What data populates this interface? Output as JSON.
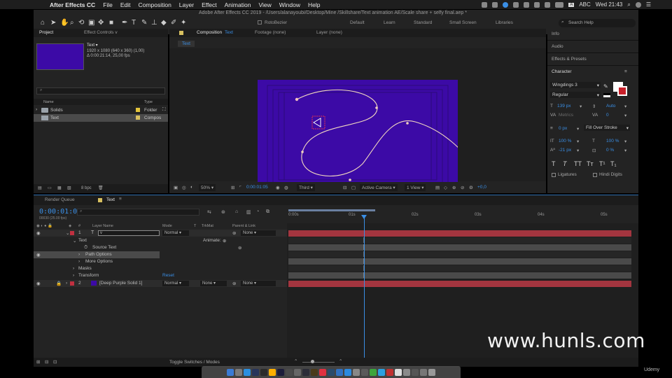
{
  "menubar": {
    "app_name": "After Effects CC",
    "items": [
      "File",
      "Edit",
      "Composition",
      "Layer",
      "Effect",
      "Animation",
      "View",
      "Window",
      "Help"
    ],
    "input_source": "ABC",
    "clock": "Wed 21:43"
  },
  "toolbar": {
    "window_title": "Adobe After Effects CC 2019 - /Users/alanayoubi/Desktop/Mine /Skillshare/Text animation AE/Scale share + selfy final.aep *",
    "rotobezier": "RotoBezier",
    "workspaces": [
      "Default",
      "Learn",
      "Standard",
      "Small Screen",
      "Libraries"
    ],
    "search_placeholder": "Search Help"
  },
  "project": {
    "tab_project": "Project",
    "tab_effects": "Effect Controls v",
    "selected_name": "Text ▾",
    "selected_dims": "1920 x 1080  (640 x 360) (1,00)",
    "selected_duration": "Δ 0:00:21:14, 25,00 fps",
    "search_placeholder": "",
    "col_name": "Name",
    "col_type": "Type",
    "rows": [
      {
        "name": "Solids",
        "type": "Folder",
        "label_color": "#e3c43b"
      },
      {
        "name": "Text",
        "type": "Compos",
        "label_color": "#d8c060"
      }
    ],
    "bpc": "8 bpc"
  },
  "viewer": {
    "tab_comp_prefix": "Composition",
    "tab_comp_name": "Text",
    "tab_footage": "Footage (none)",
    "tab_layer": "Layer (none)",
    "breadcrumb": "Text",
    "zoom": "50%",
    "timecode": "0:00:01:05",
    "resolution": "Third",
    "camera": "Active Camera",
    "views": "1 View",
    "exposure": "+0,0"
  },
  "right": {
    "info": "Info",
    "audio": "Audio",
    "effects_presets": "Effects & Presets",
    "character": "Character",
    "font": "Wingdings 3",
    "style": "Regular",
    "font_size": "139 px",
    "leading": "Auto",
    "kerning_label": "Metrics",
    "tracking": "0",
    "stroke_width": "0 px",
    "stroke_type": "Fill Over Stroke",
    "vscale": "100 %",
    "hscale": "100 %",
    "baseline": "-21 px",
    "tsume": "0 %",
    "styles": [
      "T",
      "T",
      "TT",
      "Tт",
      "T¹",
      "T₁"
    ],
    "ligatures": "Ligatures",
    "hindi_digits": "Hindi Digits"
  },
  "timeline": {
    "tab_render": "Render Queue",
    "tab_text": "Text",
    "timecode": "0:00:01:05",
    "timecode_sub": "00030 (25.00 fps)",
    "search_placeholder": "",
    "cols": {
      "num": "#",
      "layer": "Layer Name",
      "mode": "Mode",
      "t": "T",
      "trkmat": "TrkMat",
      "parent": "Parent & Link"
    },
    "layer1": {
      "num": "1",
      "name": "v",
      "mode": "Normal",
      "parent": "None"
    },
    "text_group": "Text",
    "animate": "Animate:",
    "source_text": "Source Text",
    "path_options": "Path Options",
    "more_options": "More Options",
    "masks": "Masks",
    "transform": "Transform",
    "reset": "Reset",
    "layer2": {
      "num": "2",
      "name": "[Deep Purple Solid 1]",
      "mode": "Normal",
      "trkmat": "None",
      "parent": "None"
    },
    "ruler_ticks": [
      "0:00s",
      "01s",
      "02s",
      "03s",
      "04s",
      "05s"
    ],
    "toggle": "Toggle Switches / Modes"
  },
  "watermark": "www.hunls.com",
  "udemy": "Udemy"
}
